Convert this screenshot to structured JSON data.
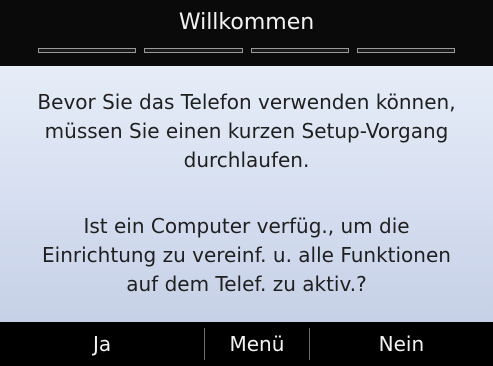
{
  "header": {
    "title": "Willkommen",
    "progress_segments": 4
  },
  "message": {
    "paragraph1": "Bevor Sie das Telefon verwenden können,\nmüssen Sie einen kurzen Setup-Vorgang\ndurchlaufen.",
    "paragraph2": "Ist ein Computer verfüg., um die\nEinrichtung zu vereinf. u. alle Funktionen\nauf dem Telef. zu aktiv.?"
  },
  "softkeys": {
    "left_label": "Ja",
    "middle_label": "Menü",
    "right_label": "Nein"
  },
  "colors": {
    "content_bg_top": "#e6edf8",
    "content_bg_bottom": "#c6d0e6",
    "bar_bg": "#000000",
    "text_light": "#f2f2f2",
    "text_dark": "#1f1f1f"
  }
}
